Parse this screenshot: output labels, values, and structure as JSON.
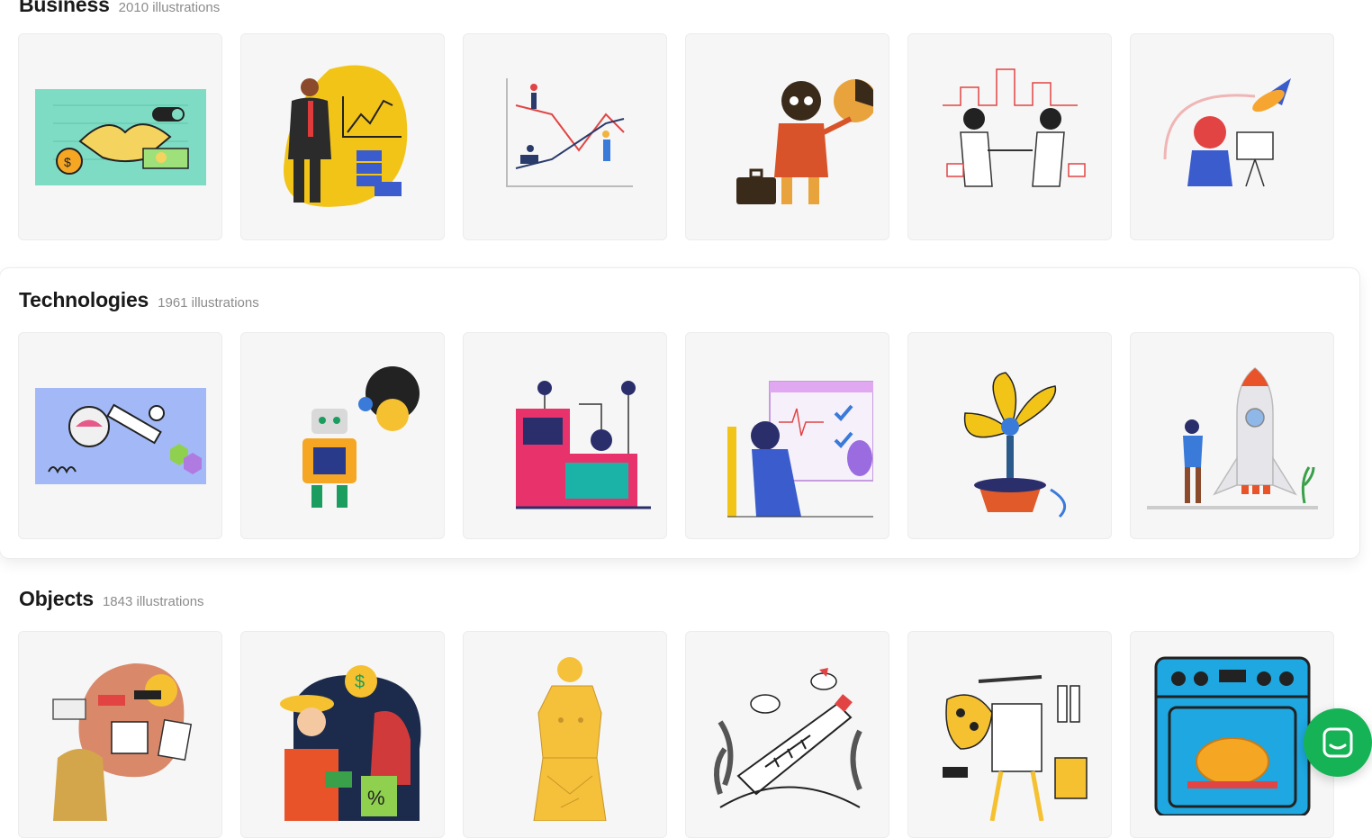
{
  "sections": [
    {
      "title": "Business",
      "count": "2010 illustrations",
      "items": [
        "handshake-illustration",
        "businessman-chart-illustration",
        "growth-graph-illustration",
        "presenter-pie-chart-illustration",
        "city-handshake-illustration",
        "rocket-idea-illustration"
      ]
    },
    {
      "title": "Technologies",
      "count": "1961 illustrations",
      "items": [
        "satellite-illustration",
        "robot-illustration",
        "server-machine-illustration",
        "monitor-analytics-illustration",
        "tech-plant-illustration",
        "rocket-launch-illustration"
      ]
    },
    {
      "title": "Objects",
      "count": "1843 illustrations",
      "items": [
        "backpack-study-illustration",
        "shopping-sale-illustration",
        "statue-illustration",
        "fish-bottle-illustration",
        "art-easel-illustration",
        "oven-turkey-illustration"
      ]
    }
  ],
  "colors": {
    "accent_green": "#16b356",
    "card_bg": "#f6f6f6",
    "title_text": "#1a1a1a",
    "count_text": "#8c8c8c"
  },
  "chat_button": {
    "icon": "chat-icon"
  }
}
